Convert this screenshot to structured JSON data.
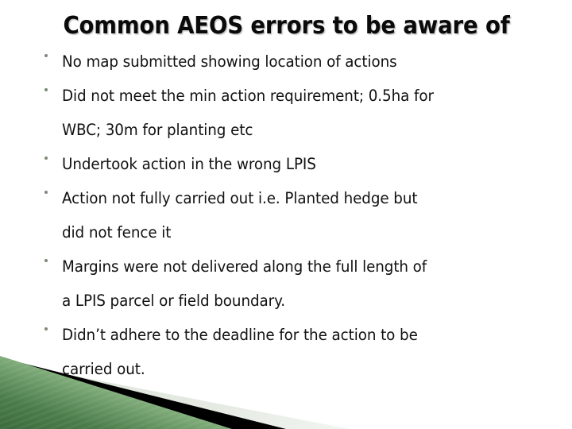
{
  "slide": {
    "title": "Common AEOS errors to be aware of",
    "background_color": "#ffffff",
    "title_color": "#0a0a0a",
    "bullet_color": "#111111",
    "bullet_marker_color": "#7d8a78"
  },
  "bullets": [
    {
      "text": "No map submitted showing location of actions"
    },
    {
      "text": "Did not meet the min action requirement; 0.5ha for\nWBC; 30m for planting etc"
    },
    {
      "text": "Undertook action in the wrong LPIS"
    },
    {
      "text": "Action not fully carried out i.e. Planted hedge but\ndid not fence it"
    },
    {
      "text": "Margins were not delivered along the full length of\na LPIS parcel or field boundary."
    },
    {
      "text": "Didn’t adhere to the deadline for the action to be\ncarried out."
    }
  ],
  "decoration": {
    "name": "bottom-left-corner-graphic",
    "green_dark": "#3f7040",
    "green_mid": "#6d9f6b",
    "green_light": "#a8c9a2",
    "black_stripe": "#000000",
    "pale_band": "#e2e8e0"
  }
}
